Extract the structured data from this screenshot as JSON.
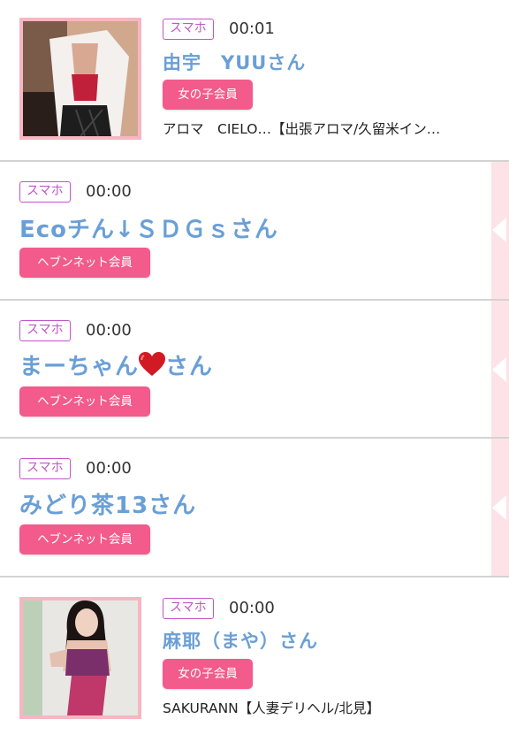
{
  "colors": {
    "name_blue": "#6a9fd6",
    "badge_purple": "#c254c9",
    "member_pink": "#f25b8c",
    "photo_frame": "#f7b6c2",
    "side_panel": "#fde3e7"
  },
  "entries": [
    {
      "device": "スマホ",
      "time": "00:01",
      "name": "由宇　YUUさん",
      "member_label": "女の子会員",
      "shop": "アロマ　CIELO…【出張アロマ/久留米イン…",
      "photo": "girl-photo"
    },
    {
      "device": "スマホ",
      "time": "00:00",
      "name": "Ecoチん↓ＳＤＧｓさん",
      "member_label": "ヘブンネット会員"
    },
    {
      "device": "スマホ",
      "time": "00:00",
      "name_prefix": "まーちゃん",
      "name_suffix": "さん",
      "name_icon": "red-heart-icon",
      "member_label": "ヘブンネット会員"
    },
    {
      "device": "スマホ",
      "time": "00:00",
      "name": "みどり茶13さん",
      "member_label": "ヘブンネット会員"
    },
    {
      "device": "スマホ",
      "time": "00:00",
      "name": "麻耶（まや）さん",
      "member_label": "女の子会員",
      "shop": "SAKURANN【人妻デリヘル/北見】",
      "photo": "girl-photo"
    }
  ]
}
